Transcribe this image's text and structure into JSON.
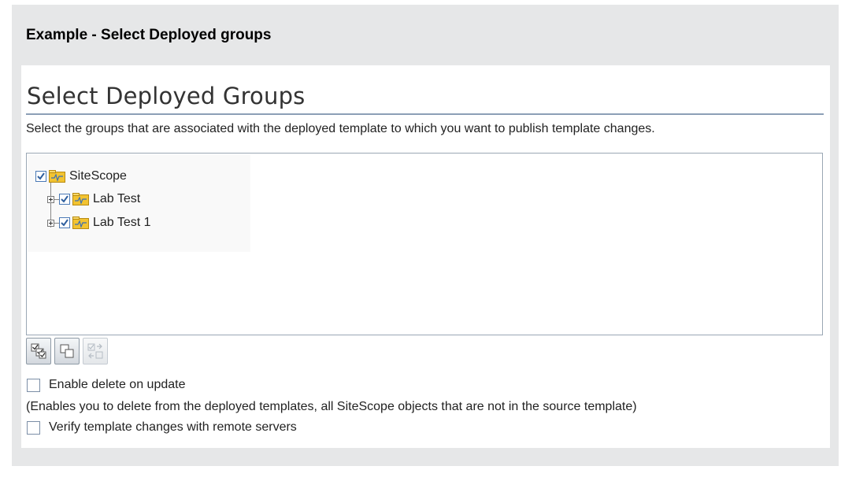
{
  "example_title": "Example - Select Deployed groups",
  "panel": {
    "heading": "Select Deployed Groups",
    "description": "Select the groups that are associated with the deployed template to which you want to publish template changes."
  },
  "tree": {
    "nodes": [
      {
        "label": "SiteScope",
        "checked": true
      },
      {
        "label": "Lab Test",
        "checked": true,
        "expandable": true
      },
      {
        "label": "Lab Test 1",
        "checked": true,
        "expandable": true
      }
    ]
  },
  "toolbar": {
    "buttons": [
      {
        "icon": "select-all-icon",
        "enabled": true
      },
      {
        "icon": "clear-selection-icon",
        "enabled": true
      },
      {
        "icon": "invert-selection-icon",
        "enabled": false
      }
    ]
  },
  "options": {
    "enable_delete_label": "Enable delete on update",
    "enable_delete_checked": false,
    "enable_delete_note": "(Enables you to delete from the deployed templates, all SiteScope objects that are not in the source template)",
    "verify_label": "Verify template changes with remote servers",
    "verify_checked": false
  },
  "colors": {
    "outer_background": "#e6e7e8",
    "heading_rule": "#8c9fb6",
    "checkbox_border": "#4a79b5",
    "folder_fill": "#f2c331"
  }
}
